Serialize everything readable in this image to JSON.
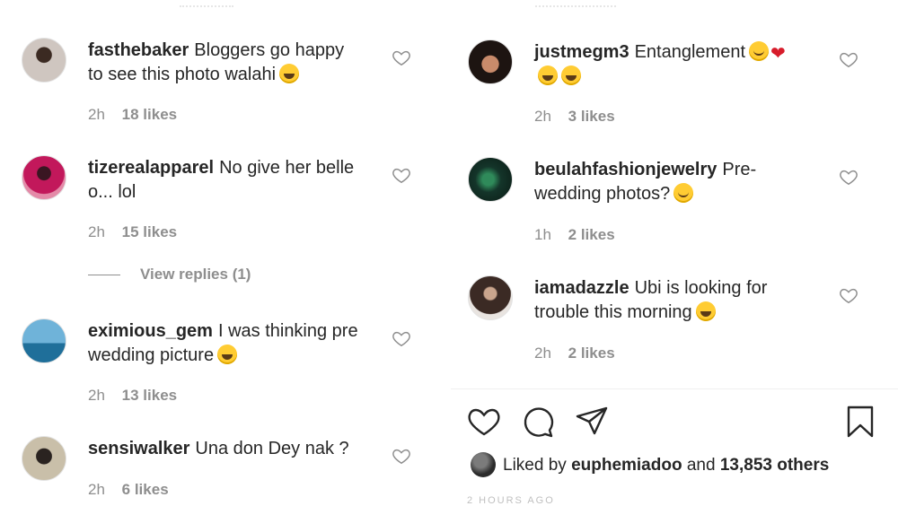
{
  "left_comments": [
    {
      "username": "fasthebaker",
      "text": "Bloggers go happy to see this photo walahi",
      "line1": "Bloggers go happy",
      "line2": "to see this photo walahi",
      "emoji": "grin-sweat",
      "time": "2h",
      "likes": "18 likes"
    },
    {
      "username": "tizerealapparel",
      "text": "No give her belle o... lol",
      "line1": "No give her belle",
      "line2": "o... lol",
      "emoji": "",
      "time": "2h",
      "likes": "15 likes"
    },
    {
      "username": "eximious_gem",
      "text": "I was thinking pre wedding picture",
      "line1": "I was thinking pre",
      "line2": "wedding picture",
      "emoji": "grin-sweat",
      "time": "2h",
      "likes": "13 likes"
    },
    {
      "username": "sensiwalker",
      "text": "Una don Dey nak ?",
      "line1": "Una don Dey nak ?",
      "line2": "",
      "emoji": "",
      "time": "2h",
      "likes": "6 likes"
    }
  ],
  "view_replies": "View replies (1)",
  "right_comments": [
    {
      "username": "justmegm3",
      "line1": "Entanglement",
      "emoji": "kiss-heart",
      "time": "2h",
      "likes": "3 likes"
    },
    {
      "username": "beulahfashionjewelry",
      "line1": "Pre-",
      "line2": "wedding photos?",
      "emoji": "smile",
      "time": "1h",
      "likes": "2 likes"
    },
    {
      "username": "iamadazzle",
      "line1": "Ubi is looking for",
      "line2": "trouble this morning",
      "emoji": "grin-sweat",
      "time": "2h",
      "likes": "2 likes"
    }
  ],
  "liked_by": {
    "prefix": "Liked by",
    "user": "euphemiadoo",
    "middle": "and",
    "others": "13,853 others"
  },
  "timestamp_cut": "2 HOURS AGO",
  "icons": {
    "like": "heart-outline-icon",
    "comment": "comment-bubble-icon",
    "share": "paper-plane-icon",
    "save": "bookmark-icon"
  },
  "colors": {
    "text": "#262626",
    "muted": "#8e8e8e",
    "emoji": "#ffcc33",
    "heart": "#d71c2b"
  }
}
